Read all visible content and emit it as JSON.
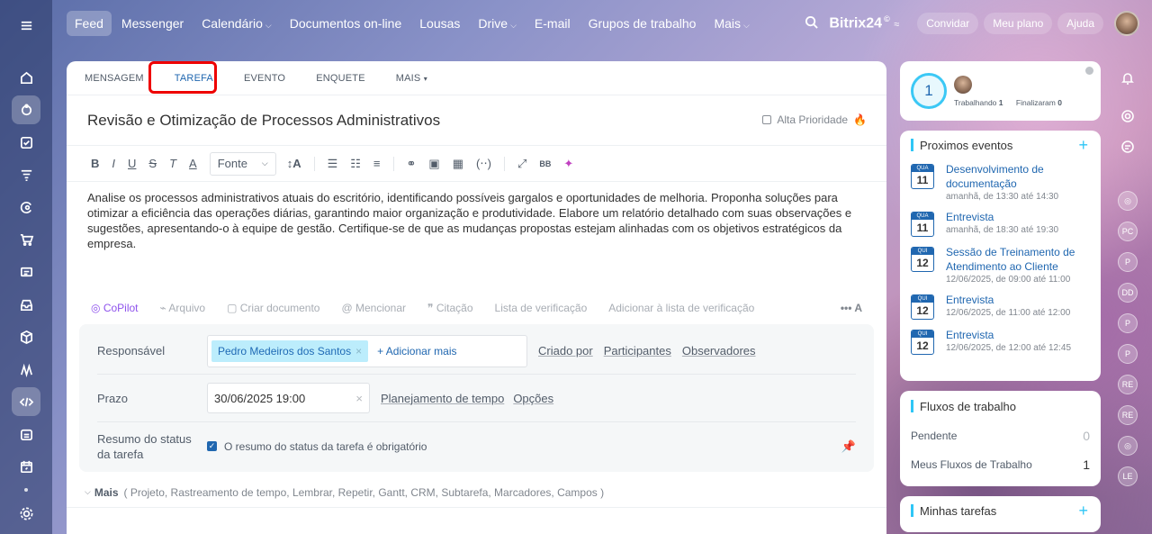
{
  "topnav": {
    "items": [
      {
        "label": "Feed",
        "active": true,
        "chevron": false
      },
      {
        "label": "Messenger",
        "chevron": false
      },
      {
        "label": "Calendário",
        "chevron": true
      },
      {
        "label": "Documentos on-line",
        "chevron": false
      },
      {
        "label": "Lousas",
        "chevron": false
      },
      {
        "label": "Drive",
        "chevron": true
      },
      {
        "label": "E-mail",
        "chevron": false
      },
      {
        "label": "Grupos de trabalho",
        "chevron": false
      },
      {
        "label": "Mais",
        "chevron": true
      }
    ],
    "brand": "Bitrix24",
    "brand_mark": "©",
    "invite": "Convidar",
    "plan": "Meu plano",
    "help": "Ajuda"
  },
  "tabs": [
    "MENSAGEM",
    "TAREFA",
    "EVENTO",
    "ENQUETE",
    "MAIS"
  ],
  "active_tab": "TAREFA",
  "task": {
    "title": "Revisão e Otimização de Processos Administrativos",
    "high_priority": "Alta Prioridade",
    "description": "Analise os processos administrativos atuais do escritório, identificando possíveis gargalos e oportunidades de melhoria. Proponha soluções para otimizar a eficiência das operações diárias, garantindo maior organização e produtividade. Elabore um relatório detalhado com suas observações e sugestões, apresentando-o à equipe de gestão. Certifique-se de que as mudanças propostas estejam alinhadas com os objetivos estratégicos da empresa."
  },
  "toolbar": {
    "font": "Fonte",
    "bold": "B",
    "italic": "I",
    "underline": "U",
    "strike": "S",
    "clear": "T",
    "color": "A",
    "size": "↕A"
  },
  "attachments": {
    "copilot": "CoPilot",
    "file": "Arquivo",
    "doc": "Criar documento",
    "mention": "Mencionar",
    "quote": "Citação",
    "checklist": "Lista de verificação",
    "add_checklist": "Adicionar à lista de verificação",
    "more": "••• A"
  },
  "form": {
    "responsible_label": "Responsável",
    "responsible_chip": "Pedro Medeiros dos Santos",
    "add_more": "+ Adicionar mais",
    "created_by": "Criado por",
    "participants": "Participantes",
    "observers": "Observadores",
    "deadline_label": "Prazo",
    "deadline_value": "30/06/2025 19:00",
    "time_planning": "Planejamento de tempo",
    "options": "Opções",
    "summary_label": "Resumo do status da tarefa",
    "summary_check": "O resumo do status da tarefa é obrigatório"
  },
  "more_row": {
    "label": "Mais",
    "items": "( Projeto,  Rastreamento de tempo,  Lembrar,  Repetir,  Gantt,  CRM,  Subtarefa,  Marcadores,  Campos )"
  },
  "pulse": {
    "value": "1",
    "working_label": "Trabalhando",
    "working_value": "1",
    "finished_label": "Finalizaram",
    "finished_value": "0"
  },
  "events": {
    "title": "Proximos eventos",
    "items": [
      {
        "dow": "QUA",
        "day": "11",
        "name": "Desenvolvimento de documentação",
        "time": "amanhã, de 13:30 até 14:30"
      },
      {
        "dow": "QUA",
        "day": "11",
        "name": "Entrevista",
        "time": "amanhã, de 18:30 até 19:30"
      },
      {
        "dow": "QUI",
        "day": "12",
        "name": "Sessão de Treinamento de Atendimento ao Cliente",
        "time": "12/06/2025, de 09:00 até 11:00"
      },
      {
        "dow": "QUI",
        "day": "12",
        "name": "Entrevista",
        "time": "12/06/2025, de 11:00 até 12:00"
      },
      {
        "dow": "QUI",
        "day": "12",
        "name": "Entrevista",
        "time": "12/06/2025, de 12:00 até 12:45"
      }
    ]
  },
  "workflows": {
    "title": "Fluxos de trabalho",
    "pending_label": "Pendente",
    "pending_value": "0",
    "mine_label": "Meus Fluxos de Trabalho",
    "mine_value": "1"
  },
  "my_tasks": {
    "title": "Minhas tarefas"
  },
  "right_avatars": [
    "PC",
    "P",
    "DD",
    "P",
    "P",
    "RE",
    "RE",
    "LE"
  ]
}
